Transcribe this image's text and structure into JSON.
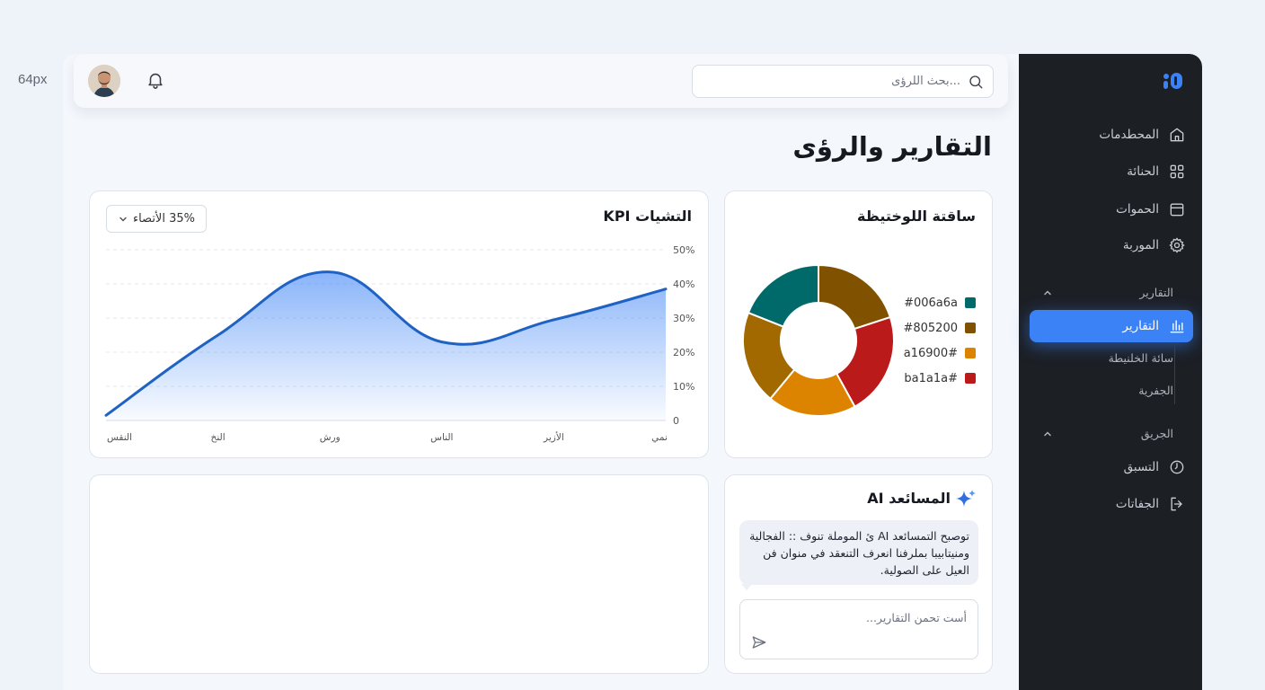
{
  "annotation": "64px",
  "page_title": "التقارير والرؤى",
  "search": {
    "placeholder": "بحث اللرؤى..."
  },
  "sidebar": {
    "items": [
      {
        "label": "المحطدمات",
        "icon": "home-icon"
      },
      {
        "label": "الحنائة",
        "icon": "grid-icon"
      },
      {
        "label": "الحموات",
        "icon": "calendar-icon"
      },
      {
        "label": "الموربة",
        "icon": "gear-icon"
      }
    ],
    "reports_section": {
      "label": "التقارير",
      "active_item": {
        "label": "التقارير",
        "icon": "bar-chart-icon"
      },
      "sub_items": [
        "سائة الخلنيطة",
        "الجفرية"
      ]
    },
    "secondary_section": {
      "label": "الجريق",
      "items": [
        {
          "label": "التسبق",
          "icon": "clock-icon"
        },
        {
          "label": "الجفاتات",
          "icon": "logout-icon"
        }
      ]
    }
  },
  "kpi_card": {
    "title": "التشيات KPI",
    "dropdown_value": "35% الأتصاء"
  },
  "donut_card": {
    "title": "ساقتة اللوختيظة",
    "legend": [
      {
        "label": "#006a6a",
        "color": "#006a6a"
      },
      {
        "label": "#805200",
        "color": "#805200"
      },
      {
        "label": "#a16900",
        "color": "#a16900"
      },
      {
        "label": "#ba1a1a",
        "color": "#ba1a1a"
      }
    ]
  },
  "ai_card": {
    "title": "المسائعد AI",
    "message": "توصبح التمسائعد AI ئ الموملة تنوف :: الفجالية ومنيتابيبا بملرفنا انعرف التنعقد في منوان فن العيل على الصولية.",
    "input_placeholder": "أست تحمن التقارير..."
  },
  "chart_data": {
    "type": "area",
    "categories": [
      "نمي",
      "الأزير",
      "الناس",
      "ورش",
      "النخ",
      "النقس"
    ],
    "x": [
      0,
      1,
      2,
      3,
      4,
      5
    ],
    "values": [
      38.5,
      29.5,
      23,
      43.5,
      25,
      1.5
    ],
    "yticks": [
      "50%",
      "40%",
      "30%",
      "20%",
      "10%",
      "0"
    ],
    "ylim": [
      0,
      50
    ],
    "color": "#1e63c4",
    "grid": true
  },
  "donut_data": {
    "type": "pie",
    "slices": [
      {
        "value": 20,
        "color": "#805200"
      },
      {
        "value": 22,
        "color": "#ba1a1a"
      },
      {
        "value": 19,
        "color": "#dc8400"
      },
      {
        "value": 20,
        "color": "#a16900"
      },
      {
        "value": 19,
        "color": "#006a6a"
      }
    ]
  }
}
